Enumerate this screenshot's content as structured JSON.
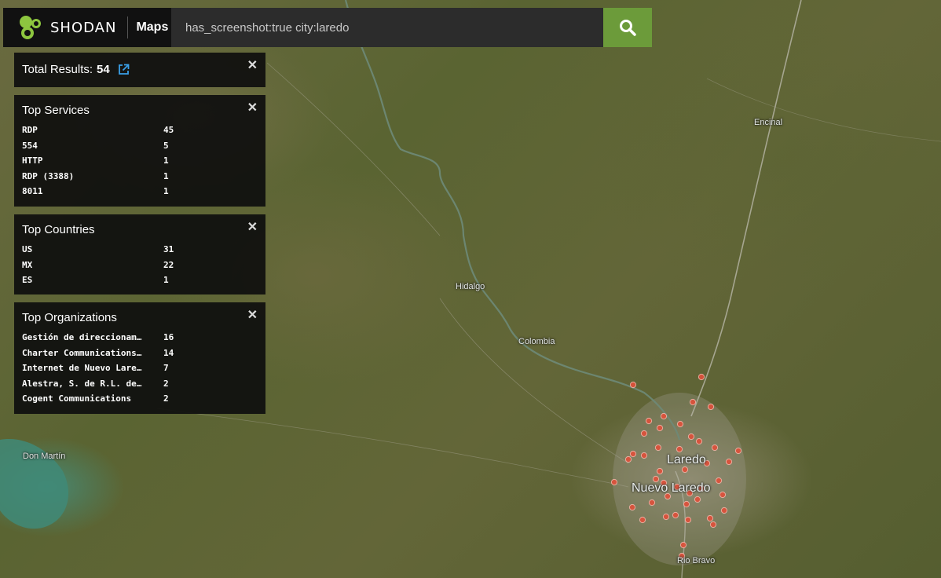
{
  "brand": {
    "name": "SHODAN",
    "section": "Maps"
  },
  "search": {
    "query": "has_screenshot:true city:laredo"
  },
  "total": {
    "label": "Total Results:",
    "count": "54"
  },
  "panels": {
    "services": {
      "title": "Top Services",
      "rows": [
        {
          "name": "RDP",
          "count": "45"
        },
        {
          "name": "554",
          "count": "5"
        },
        {
          "name": "HTTP",
          "count": "1"
        },
        {
          "name": "RDP (3388)",
          "count": "1"
        },
        {
          "name": "8011",
          "count": "1"
        }
      ]
    },
    "countries": {
      "title": "Top Countries",
      "rows": [
        {
          "name": "US",
          "count": "31"
        },
        {
          "name": "MX",
          "count": "22"
        },
        {
          "name": "ES",
          "count": "1"
        }
      ]
    },
    "organizations": {
      "title": "Top Organizations",
      "rows": [
        {
          "name": "Gestión de direccionam…",
          "count": "16"
        },
        {
          "name": "Charter Communications…",
          "count": "14"
        },
        {
          "name": "Internet de Nuevo Lare…",
          "count": "7"
        },
        {
          "name": "Alestra, S. de R.L. de…",
          "count": "2"
        },
        {
          "name": "Cogent Communications",
          "count": "2"
        }
      ]
    }
  },
  "map": {
    "places": {
      "encinal": "Encinal",
      "hidalgo": "Hidalgo",
      "colombia": "Colombia",
      "don_martin": "Don Martín",
      "laredo": "Laredo",
      "nuevo_laredo": "Nuevo Laredo",
      "rio_bravo": "Rio Bravo"
    },
    "marker_color": "#e0503a"
  },
  "colors": {
    "search_button": "#6c9b3a",
    "panel_bg": "#0e0e0e",
    "link": "#3aa0e8"
  },
  "icons": {
    "search": "search-icon",
    "close": "close-icon",
    "external": "external-link-icon",
    "logo": "shodan-logo-icon"
  }
}
